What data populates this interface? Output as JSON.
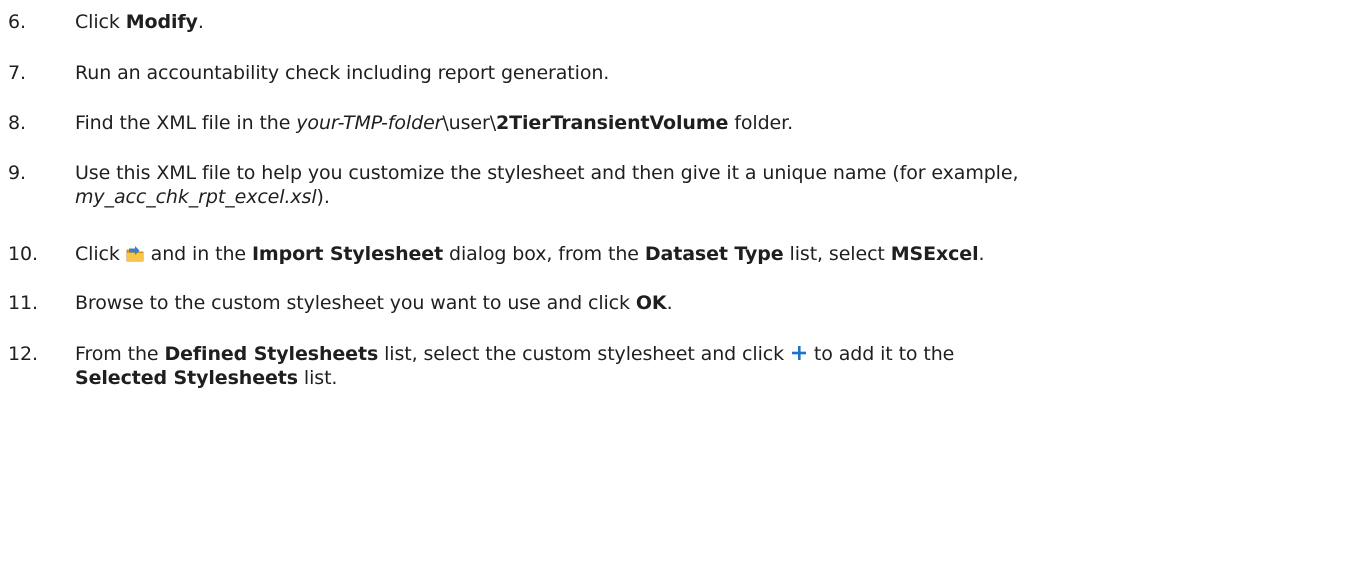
{
  "steps": [
    {
      "number": "6.",
      "parts": [
        "Click ",
        "Modify",
        "."
      ]
    },
    {
      "number": "7.",
      "parts": [
        "Run an accountability check including report generation."
      ]
    },
    {
      "number": "8.",
      "parts": [
        "Find the XML file in the ",
        "your-TMP-folder",
        "\\user\\",
        "2TierTransientVolume",
        " folder."
      ]
    },
    {
      "number": "9.",
      "line1": "Use this XML file to help you customize the stylesheet and then give it a unique name (for example,",
      "line2_italic": "my_acc_chk_rpt_excel.xsl",
      "line2_end": ")."
    },
    {
      "number": "10.",
      "parts": [
        "Click ",
        " and in the ",
        "Import Stylesheet",
        " dialog box, from the ",
        "Dataset Type",
        " list, select ",
        "MSExcel",
        "."
      ],
      "icon": "import-stylesheet-icon"
    },
    {
      "number": "11.",
      "parts": [
        "Browse to the custom stylesheet you want to use and click ",
        "OK",
        "."
      ]
    },
    {
      "number": "12.",
      "parts": [
        "From the ",
        "Defined Stylesheets",
        " list, select the custom stylesheet and click ",
        " to add it to the"
      ],
      "line2_bold": "Selected Stylesheets",
      "line2_end": " list.",
      "icon": "add-plus-icon"
    }
  ],
  "colors": {
    "text": "#1f1f1f",
    "plus_icon": "#1e73c8",
    "import_icon_folder": "#e8a317",
    "import_icon_arrow": "#3a7fc2"
  }
}
